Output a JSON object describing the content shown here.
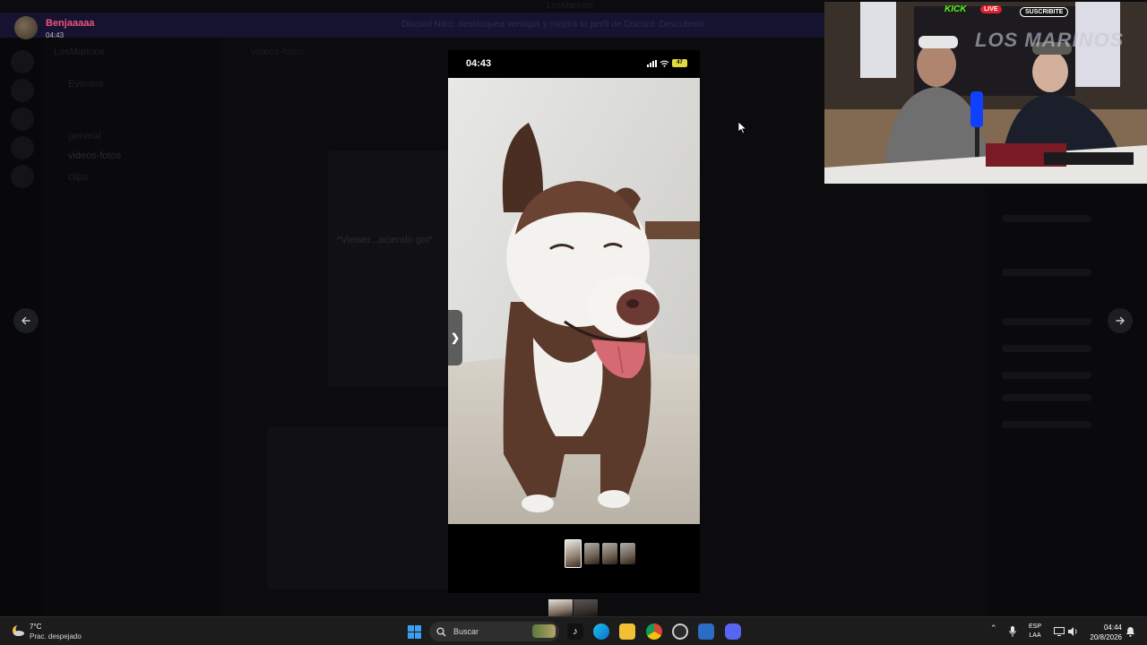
{
  "window": {
    "title": "LosMarinos"
  },
  "banner": {
    "text": "Discord Nitro: desbloquea ventajas y mejora tu perfil de Discord. Descúbrelo"
  },
  "background": {
    "server_name": "LosMarinos",
    "channels": [
      "Eventos",
      "general",
      "videos-fotos",
      "clips"
    ],
    "channel_header": "videos-fotos",
    "video_caption": "*Viewer...aciendo gol*"
  },
  "viewer": {
    "uploader_name": "Benjaaaaa",
    "upload_time": "04:43",
    "prev_icon": "arrow-left-icon",
    "next_icon": "arrow-right-icon"
  },
  "phone": {
    "status_time": "04:43",
    "battery_level": "47",
    "side_handle_glyph": "❯",
    "thumbnail_count": 4,
    "selected_thumbnail": 0
  },
  "webcam": {
    "platform": "KICK",
    "live_badge": "LIVE",
    "subscribe_badge": "SUSCRIBITE",
    "logo_text": "LOS MARINOS"
  },
  "taskbar": {
    "weather_temp": "7°C",
    "weather_desc": "Prac. despejado",
    "search_placeholder": "Buscar",
    "language_top": "ESP",
    "language_bottom": "LAA",
    "clock_time": "04:44",
    "clock_date": "20/8/2026",
    "colors": {
      "start": "#3aa0f3",
      "discord": "#5865f2",
      "accent_name": "#f0547a"
    }
  }
}
